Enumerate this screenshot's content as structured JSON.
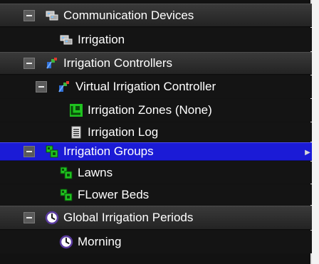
{
  "tree": {
    "communication_devices": {
      "label": "Communication Devices",
      "icon": "network-device-icon"
    },
    "irrigation_device": {
      "label": "Irrigation",
      "icon": "network-device-icon"
    },
    "irrigation_controllers": {
      "label": "Irrigation Controllers",
      "icon": "controller-icon"
    },
    "virtual_controller": {
      "label": "Virtual Irrigation Controller",
      "icon": "controller-icon"
    },
    "irrigation_zones": {
      "label": "Irrigation Zones (None)",
      "icon": "zone-icon"
    },
    "irrigation_log": {
      "label": "Irrigation Log",
      "icon": "log-icon"
    },
    "irrigation_groups": {
      "label": "Irrigation Groups",
      "icon": "group-icon"
    },
    "lawns": {
      "label": "Lawns",
      "icon": "group-icon"
    },
    "flower_beds": {
      "label": "FLower Beds",
      "icon": "group-icon"
    },
    "global_periods": {
      "label": "Global Irrigation Periods",
      "icon": "clock-icon"
    },
    "morning": {
      "label": "Morning",
      "icon": "clock-icon"
    }
  },
  "colors": {
    "background": "#121212",
    "header_row": "#2e2e2e",
    "selected_row": "#1b1bd6",
    "text": "#ffffff"
  }
}
